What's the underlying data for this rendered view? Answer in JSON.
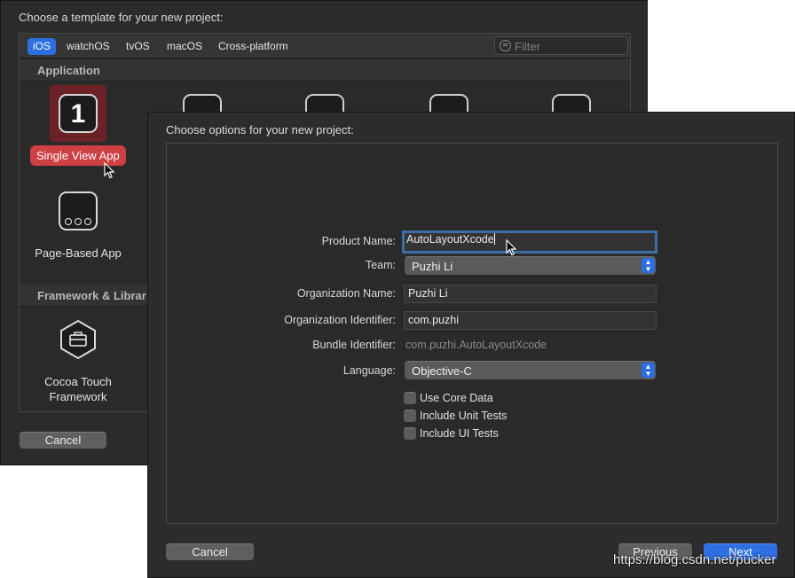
{
  "back_window": {
    "title": "Choose a template for your new project:",
    "platform_tabs": [
      "iOS",
      "watchOS",
      "tvOS",
      "macOS",
      "Cross-platform"
    ],
    "active_tab": "iOS",
    "filter_placeholder": "Filter",
    "sections": {
      "application": "Application",
      "framework": "Framework & Librar"
    },
    "templates": {
      "single_view": "Single View App",
      "single_view_icon_text": "1",
      "page_based": "Page-Based App",
      "cocoa_touch_line1": "Cocoa Touch",
      "cocoa_touch_line2": "Framework"
    },
    "cancel_label": "Cancel"
  },
  "dialog": {
    "title": "Choose options for your new project:",
    "fields": {
      "product_name_label": "Product Name:",
      "product_name_value": "AutoLayoutXcode",
      "team_label": "Team:",
      "team_value": "Puzhi Li",
      "org_name_label": "Organization Name:",
      "org_name_value": "Puzhi Li",
      "org_id_label": "Organization Identifier:",
      "org_id_value": "com.puzhi",
      "bundle_id_label": "Bundle Identifier:",
      "bundle_id_value": "com.puzhi.AutoLayoutXcode",
      "language_label": "Language:",
      "language_value": "Objective-C"
    },
    "checkboxes": {
      "core_data": "Use Core Data",
      "unit_tests": "Include Unit Tests",
      "ui_tests": "Include UI Tests"
    },
    "buttons": {
      "cancel": "Cancel",
      "previous": "Previous",
      "next": "Next"
    }
  },
  "watermark": "https://blog.csdn.net/pucker",
  "colors": {
    "accent_blue": "#2f6fe4",
    "selection_red": "#cf4045",
    "focus_ring": "#3c6ea6"
  }
}
